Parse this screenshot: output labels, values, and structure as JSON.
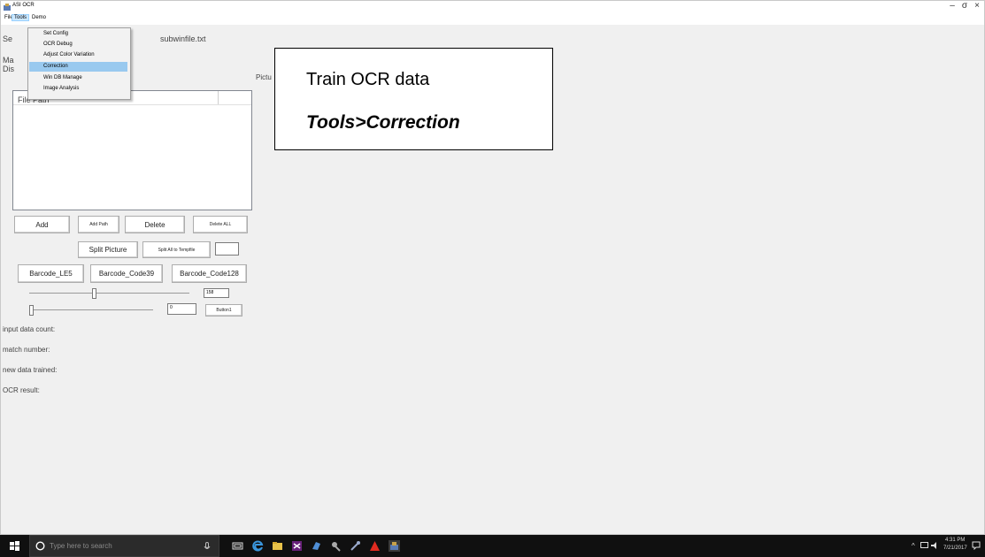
{
  "window": {
    "title": "ASI OCR",
    "controls": {
      "minimize": "–",
      "maximize": "σ",
      "close": "×"
    }
  },
  "menubar": {
    "file": "File",
    "tools": "Tools",
    "demo": "Demo"
  },
  "tools_menu": {
    "items": [
      "Set Config",
      "OCR Debug",
      "Adjust Color Variation",
      "Correction",
      "Win DB Manage",
      "Image Analysis"
    ],
    "highlighted": "Correction"
  },
  "form": {
    "label_se": "Se",
    "label_ma": "Ma",
    "label_dis": "Dis",
    "subwinfile": "subwinfile.txt",
    "pictu_label": "Pictu",
    "list_header": "File Path",
    "buttons": {
      "add": "Add",
      "add_path": "Add Path",
      "delete": "Delete",
      "delete_all": "Delete ALL",
      "split_picture": "Split Picture",
      "split_all": "Split All to Tempfile",
      "barcode_le5": "Barcode_LE5",
      "barcode_code39": "Barcode_Code39",
      "barcode_code128": "Barcode_Code128",
      "button1": "Button1"
    },
    "slider1_value": "158",
    "slider2_value": "0",
    "slider1_position": 0.39,
    "slider2_position": 0.0,
    "stats": {
      "input_count": "input data count:",
      "match_number": "match number:",
      "new_trained": "new data trained:",
      "ocr_result": "OCR result:"
    }
  },
  "callout": {
    "line1": "Train OCR data",
    "line2": "Tools>Correction"
  },
  "taskbar": {
    "search_placeholder": "Type here to search",
    "time": "4:31 PM",
    "date": "7/21/2017"
  },
  "colors": {
    "menu_highlight": "#99c9ef",
    "taskbar": "#101010",
    "window_bg": "#f0f0f0"
  }
}
